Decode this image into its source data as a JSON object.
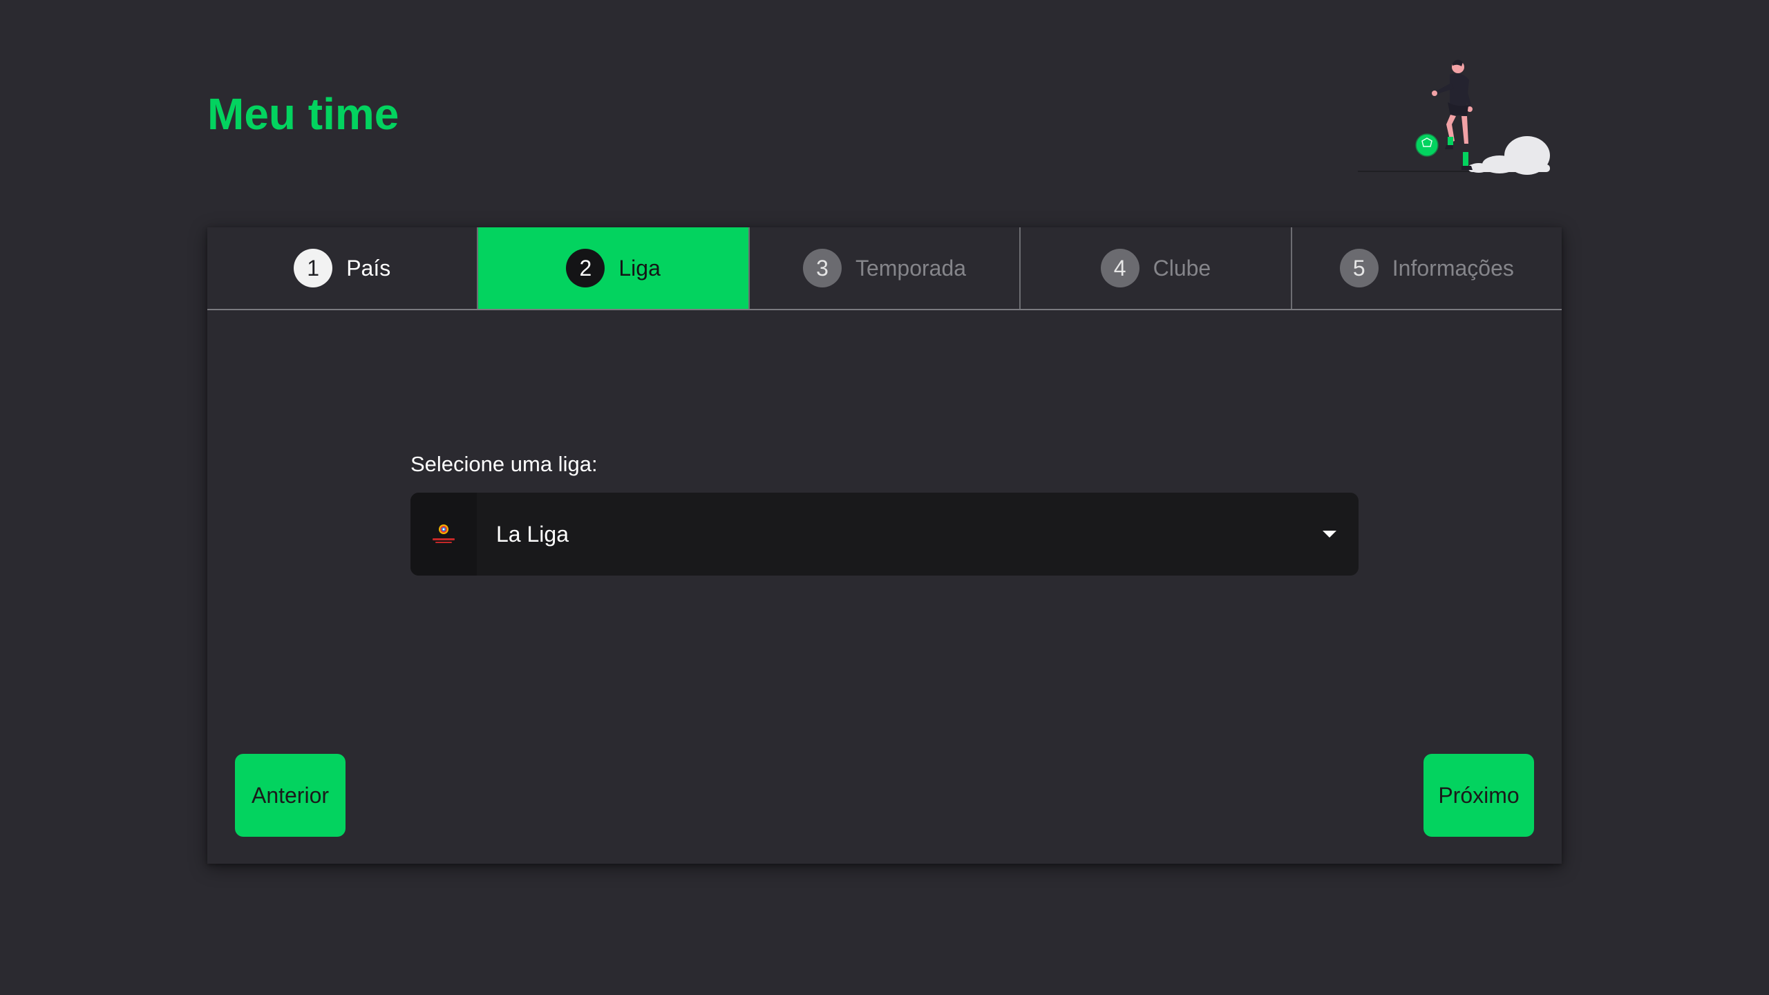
{
  "app": {
    "title": "Meu time"
  },
  "steps": [
    {
      "number": "1",
      "label": "País",
      "state": "done"
    },
    {
      "number": "2",
      "label": "Liga",
      "state": "active"
    },
    {
      "number": "3",
      "label": "Temporada",
      "state": "pending"
    },
    {
      "number": "4",
      "label": "Clube",
      "state": "pending"
    },
    {
      "number": "5",
      "label": "Informações",
      "state": "pending"
    }
  ],
  "league_select": {
    "label": "Selecione uma liga:",
    "value": "La Liga",
    "logo_icon": "laliga-logo-icon",
    "caret_icon": "chevron-down-icon"
  },
  "nav": {
    "prev_label": "Anterior",
    "next_label": "Próximo"
  },
  "colors": {
    "accent": "#03d35f",
    "background": "#2b2a30",
    "select_bg": "#19191b"
  }
}
